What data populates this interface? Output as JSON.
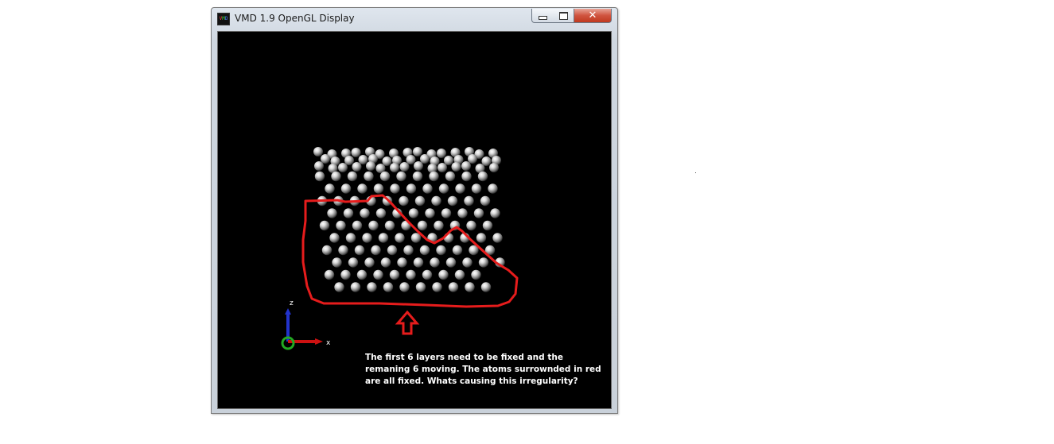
{
  "window": {
    "title": "VMD 1.9 OpenGL Display",
    "app_icon": "vmd-app-icon",
    "controls": {
      "minimize_icon": "minimize-icon",
      "maximize_icon": "maximize-icon",
      "close_label": "✕"
    }
  },
  "viewport": {
    "background": "#000000",
    "atom_color": "#d8d8d8",
    "annotation_color": "#e61c1c",
    "axes": {
      "z_label": "z",
      "x_label": "x",
      "colors": {
        "z": "#2233cc",
        "x": "#cc1111",
        "y": "#22aa22"
      }
    },
    "note": "The first 6 layers need to be fixed and the remaning 6 moving. The atoms surrownded in red are all fixed. Whats causing this irregularity?"
  }
}
